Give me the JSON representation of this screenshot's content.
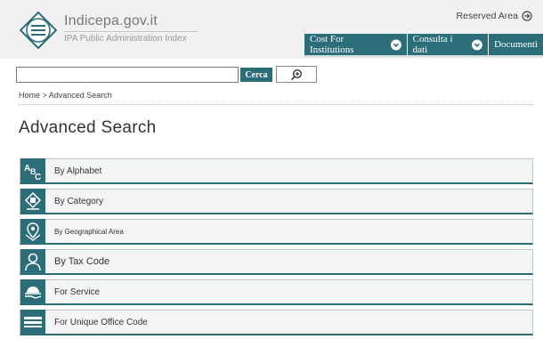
{
  "header": {
    "logo_title": "Indicepa.gov.it",
    "logo_subtitle": "IPA Public Administration Index",
    "reserved_area": "Reserved Area"
  },
  "nav": {
    "items": [
      {
        "label": "Cost For Institutions"
      },
      {
        "label": "Consulta i dati"
      },
      {
        "label": "Documenti"
      }
    ]
  },
  "search": {
    "value": "",
    "button_label": "Cerca"
  },
  "breadcrumb": "Home > Advanced Search",
  "page_title": "Advanced Search",
  "search_options": [
    {
      "label": "By Alphabet",
      "icon": "abc-icon"
    },
    {
      "label": "By Category",
      "icon": "category-icon"
    },
    {
      "label": "By Geographical Area",
      "icon": "location-pin-icon"
    },
    {
      "label": "By Tax Code",
      "icon": "person-icon"
    },
    {
      "label": "For Service",
      "icon": "service-hand-icon"
    },
    {
      "label": "For Unique Office Code",
      "icon": "office-code-icon"
    }
  ],
  "colors": {
    "accent": "#2b6d78",
    "header_bg": "#f1f1f1"
  }
}
